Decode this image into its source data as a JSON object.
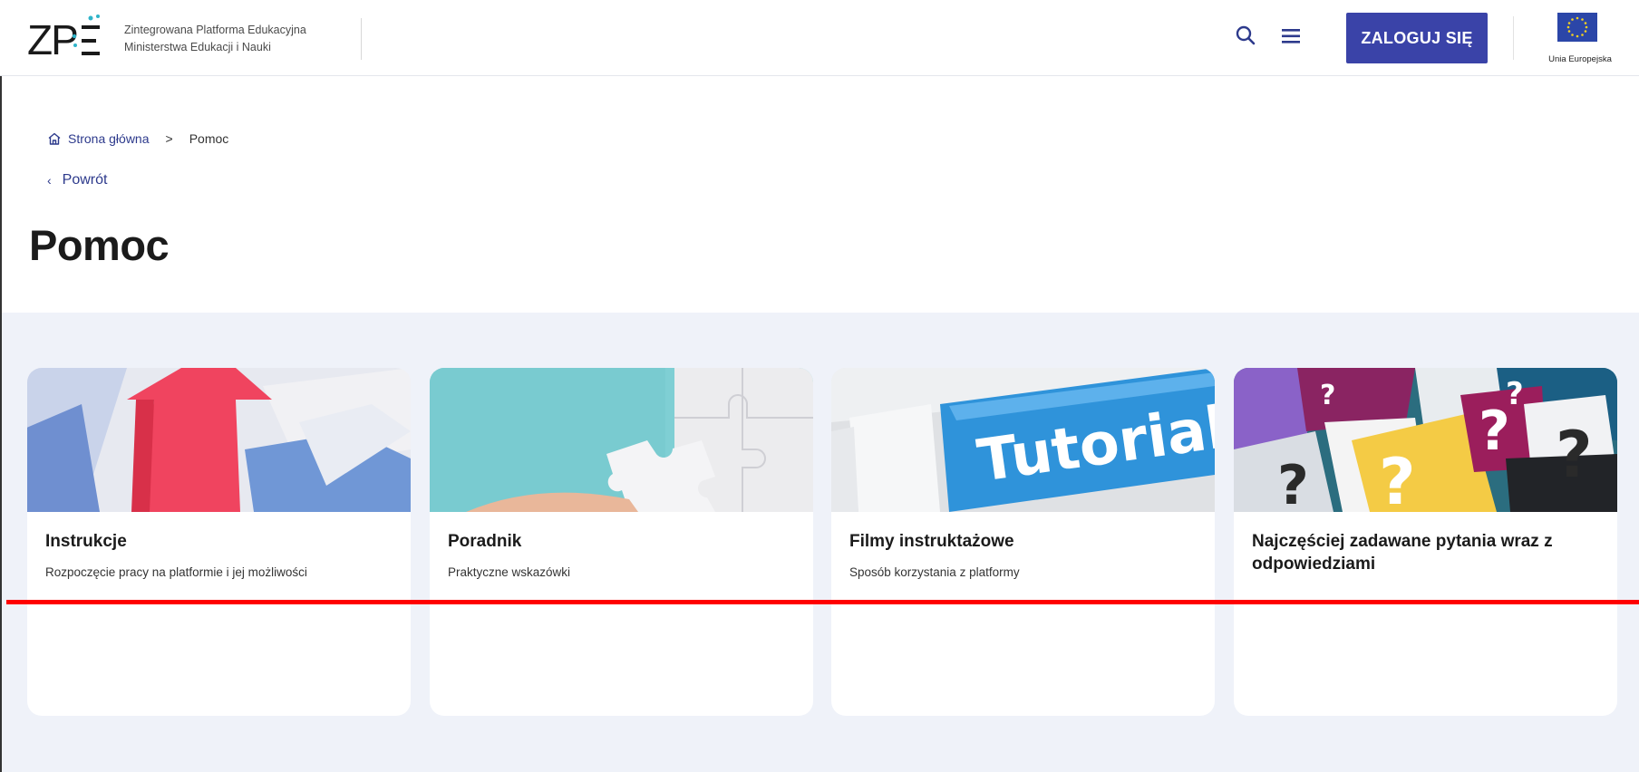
{
  "header": {
    "logo_mark": "ZPE",
    "logo_line1": "Zintegrowana Platforma Edukacyjna",
    "logo_line2": "Ministerstwa Edukacji i Nauki",
    "search_icon": "search-icon",
    "menu_icon": "hamburger-menu-icon",
    "login_label": "ZALOGUJ SIĘ",
    "eu_label": "Unia Europejska",
    "brand_color": "#3a43a8"
  },
  "breadcrumb": {
    "home_label": "Strona główna",
    "separator": ">",
    "current": "Pomoc"
  },
  "back_label": "Powrót",
  "page_title": "Pomoc",
  "cards": [
    {
      "title": "Instrukcje",
      "description": "Rozpoczęcie pracy na platformie i jej możliwości",
      "image": "colored-arrows-photo"
    },
    {
      "title": "Poradnik",
      "description": "Praktyczne wskazówki",
      "image": "puzzle-pieces-photo"
    },
    {
      "title": "Filmy instruktażowe",
      "description": "Sposób korzystania z platformy",
      "image": "tutorial-keyboard-key-photo",
      "image_text": "Tutorial"
    },
    {
      "title": "Najczęściej zadawane pytania wraz z odpowiedziami",
      "description": "",
      "image": "question-marks-photo"
    }
  ],
  "colors": {
    "content_bg": "#eff2f9",
    "link": "#2d3a8c",
    "annotation_line": "#ff0000"
  }
}
